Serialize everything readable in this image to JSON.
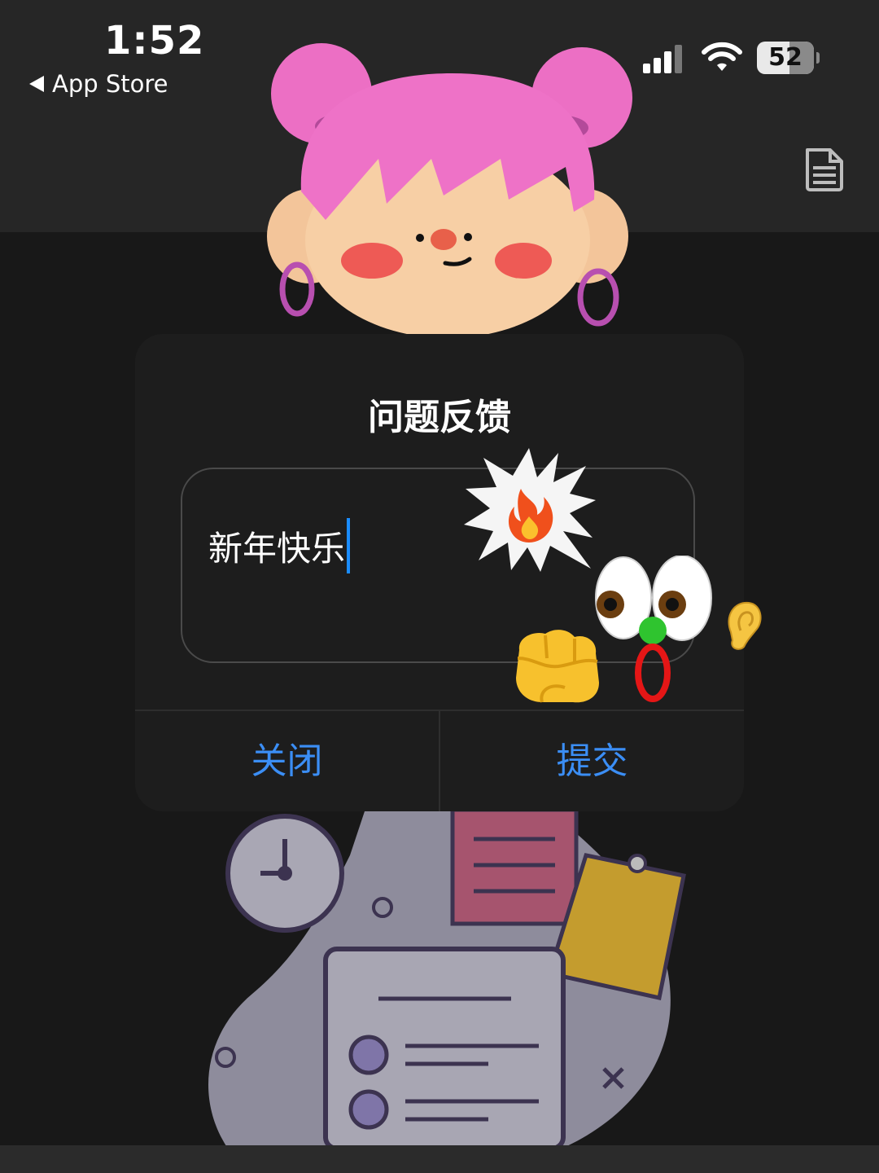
{
  "status_bar": {
    "time": "1:52",
    "back_label": "App Store",
    "battery_level": "52"
  },
  "dialog": {
    "title": "问题反馈",
    "input_value": "新年快乐",
    "close_label": "关闭",
    "submit_label": "提交"
  },
  "icons": [
    "back-arrow-icon",
    "signal-icon",
    "wifi-icon",
    "battery-icon",
    "document-icon",
    "fire-icon",
    "ear-icon",
    "fist-icon"
  ],
  "colors": {
    "accent": "#3b8ef5",
    "caret": "#1a8cff",
    "background": "#181818",
    "dialog_bg": "#1d1d1d"
  }
}
